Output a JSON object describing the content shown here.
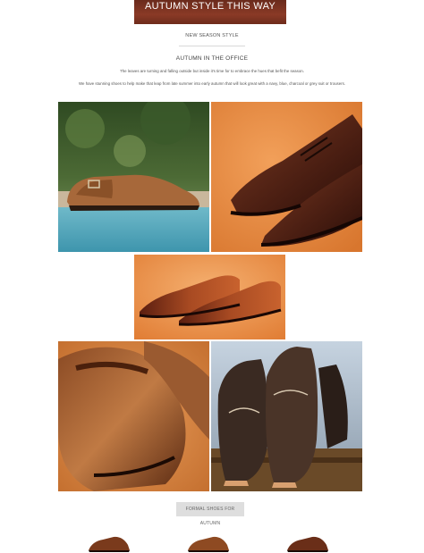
{
  "banner": {
    "title": "AUTUMN STYLE THIS WAY"
  },
  "intro": {
    "eyebrow": "NEW SEASON STYLE",
    "headline": "AUTUMN IN THE OFFICE",
    "paragraph_1": "The leaves are turning and falling outside but inside it's time for to embrace the hues that befit the season.",
    "paragraph_2": "We have stunning shoes to help make that leap from late summer into early autumn that will look great with a navy, blue, charcoal or grey suit or trousers."
  },
  "gallery": [
    {
      "icon": "suede-monk-shoe-photo"
    },
    {
      "icon": "burgundy-derby-shoe-photo"
    },
    {
      "icon": "tan-oxford-shoe-photo"
    },
    {
      "icon": "brown-loafer-closeup-photo"
    },
    {
      "icon": "black-brogue-shoe-photo"
    }
  ],
  "cta": {
    "label": "FORMAL SHOES FOR AUTUMN"
  },
  "colors": {
    "banner": "#7a3322",
    "cta_bg": "#dedede",
    "orange_bg": "#e8843a"
  }
}
